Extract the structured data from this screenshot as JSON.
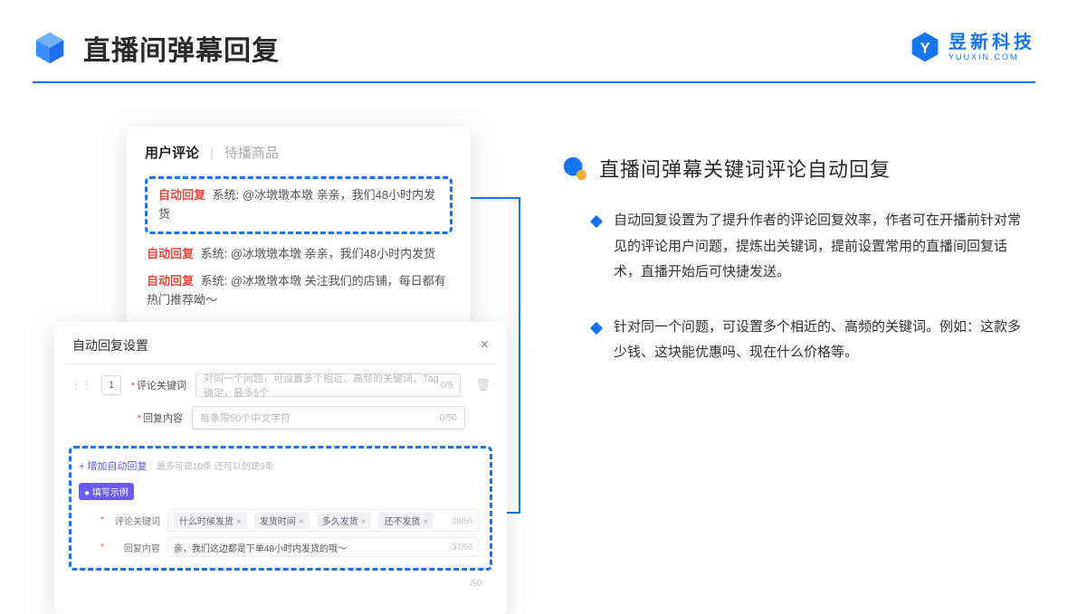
{
  "header": {
    "page_title": "直播间弹幕回复",
    "brand_name": "昱新科技",
    "brand_url": "YUUXIN.COM"
  },
  "comments_card": {
    "tab_active": "用户评论",
    "tab_inactive": "待播商品",
    "highlighted": {
      "badge": "自动回复",
      "text": "系统: @冰墩墩本墩 亲亲，我们48小时内发货"
    },
    "lines": [
      {
        "badge": "自动回复",
        "text": "系统: @冰墩墩本墩 亲亲，我们48小时内发货"
      },
      {
        "badge": "自动回复",
        "text": "系统: @冰墩墩本墩 关注我们的店铺，每日都有热门推荐呦～"
      }
    ]
  },
  "modal": {
    "title": "自动回复设置",
    "row_number": "1",
    "keyword_label": "评论关键词",
    "keyword_placeholder": "对同一个问题，可设置多个相近、高频的关键词，Tag确定，最多5个",
    "keyword_count": "0/5",
    "content_label": "回复内容",
    "content_placeholder": "每条限50个中文字符",
    "content_count": "0/50",
    "add_link": "+ 增加自动回复",
    "add_hint": "最多可建10条 还可以创建9条",
    "example_chip": "● 填写示例",
    "ex_keyword_label": "评论关键词",
    "ex_tags": [
      "什么时候发货",
      "发货时间",
      "多久发货",
      "还不发货"
    ],
    "ex_keyword_count": "20/50",
    "ex_content_label": "回复内容",
    "ex_content_value": "亲，我们这边都是下单48小时内发货的哦～",
    "ex_content_count": "37/50",
    "trailing_count": "/50"
  },
  "right": {
    "section_title": "直播间弹幕关键词评论自动回复",
    "bullets": [
      "自动回复设置为了提升作者的评论回复效率，作者可在开播前针对常见的评论用户问题，提炼出关键词，提前设置常用的直播间回复话术，直播开始后可快捷发送。",
      "针对同一个问题，可设置多个相近的、高频的关键词。例如：这款多少钱、这块能优惠吗、现在什么价格等。"
    ]
  }
}
